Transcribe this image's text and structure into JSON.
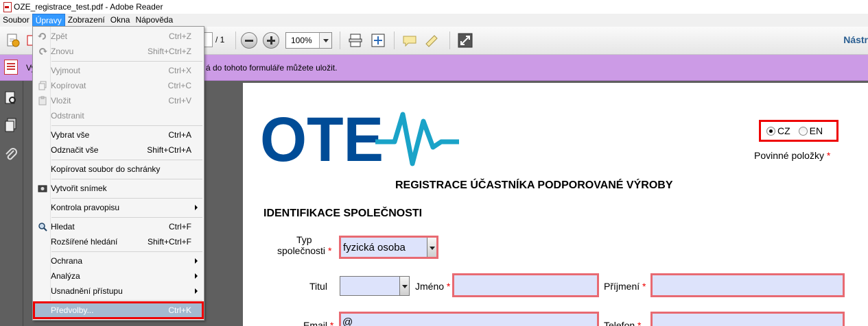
{
  "window": {
    "title": "OZE_registrace_test.pdf - Adobe Reader"
  },
  "menubar": {
    "items": [
      {
        "label": "Soubor"
      },
      {
        "label": "Úpravy"
      },
      {
        "label": "Zobrazení"
      },
      {
        "label": "Okna"
      },
      {
        "label": "Nápověda"
      }
    ],
    "active": "Úpravy"
  },
  "toolbar": {
    "page_total": "/ 1",
    "zoom": "100%",
    "tools_label": "Nástr"
  },
  "notification": {
    "prefix": "Vy",
    "message": "á do tohoto formuláře můžete uložit.",
    "color": "#cc9be6"
  },
  "edit_menu": {
    "items": [
      {
        "label": "Zpět",
        "shortcut": "Ctrl+Z",
        "enabled": false,
        "icon": "undo-icon"
      },
      {
        "label": "Znovu",
        "shortcut": "Shift+Ctrl+Z",
        "enabled": false,
        "icon": "redo-icon"
      },
      {
        "label": "Vyjmout",
        "shortcut": "Ctrl+X",
        "enabled": false
      },
      {
        "label": "Kopírovat",
        "shortcut": "Ctrl+C",
        "enabled": false,
        "icon": "copy-icon"
      },
      {
        "label": "Vložit",
        "shortcut": "Ctrl+V",
        "enabled": false,
        "icon": "paste-icon"
      },
      {
        "label": "Odstranit",
        "shortcut": "",
        "enabled": false
      },
      {
        "label": "Vybrat vše",
        "shortcut": "Ctrl+A",
        "enabled": true
      },
      {
        "label": "Odznačit vše",
        "shortcut": "Shift+Ctrl+A",
        "enabled": true
      },
      {
        "label": "Kopírovat soubor do schránky",
        "shortcut": "",
        "enabled": true
      },
      {
        "label": "Vytvořit snímek",
        "shortcut": "",
        "enabled": true,
        "icon": "camera-icon"
      },
      {
        "label": "Kontrola pravopisu",
        "shortcut": "",
        "enabled": true,
        "submenu": true
      },
      {
        "label": "Hledat",
        "shortcut": "Ctrl+F",
        "enabled": true,
        "icon": "search-icon"
      },
      {
        "label": "Rozšířené hledání",
        "shortcut": "Shift+Ctrl+F",
        "enabled": true
      },
      {
        "label": "Ochrana",
        "shortcut": "",
        "enabled": true,
        "submenu": true
      },
      {
        "label": "Analýza",
        "shortcut": "",
        "enabled": true,
        "submenu": true
      },
      {
        "label": "Usnadnění přístupu",
        "shortcut": "",
        "enabled": true,
        "submenu": true
      },
      {
        "label": "Předvolby...",
        "shortcut": "Ctrl+K",
        "enabled": true,
        "highlighted": true
      }
    ]
  },
  "form": {
    "logo_text": "OTE",
    "lang": {
      "cz": "CZ",
      "en": "EN",
      "selected": "CZ"
    },
    "required_label": "Povinné položky",
    "required_star": "*",
    "title": "REGISTRACE ÚČASTNÍKA PODPOROVANÉ VÝROBY",
    "section": "IDENTIFIKACE SPOLEČNOSTI",
    "company_type_label_1": "Typ",
    "company_type_label_2": "společnosti",
    "company_type_value": "fyzická osoba",
    "titul_label": "Titul",
    "jmeno_label": "Jméno",
    "prijmeni_label": "Příjmení",
    "email_label": "Email",
    "email_value": "@",
    "telefon_label": "Telefon",
    "field_bg": "#dde3fb",
    "field_border": "#e86a72",
    "logo_blue": "#004c97",
    "logo_cyan": "#1aa3c8"
  }
}
